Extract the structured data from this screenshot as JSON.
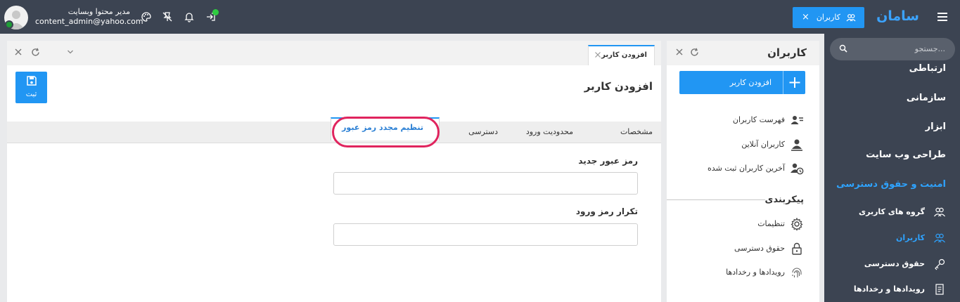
{
  "topbar": {
    "brand": "سامان",
    "open_tab": {
      "label": "کاربران",
      "icon": "users-icon",
      "close": "×"
    },
    "user": {
      "name": "مدیر محتوا وبسایت",
      "email": "content_admin@yahoo.com",
      "status_color": "#1e9d36"
    },
    "icons": [
      "palette-icon",
      "pin-off-icon",
      "bell-icon",
      "login-icon"
    ]
  },
  "sidebar": {
    "search_placeholder": "جستجو...",
    "categories": [
      {
        "label": "ارتباطی"
      },
      {
        "label": "سازمانی"
      },
      {
        "label": "ابزار"
      },
      {
        "label": "طراحی وب سایت"
      },
      {
        "label": "امنیت و حقوق دسترسی",
        "active": true
      }
    ],
    "sub_items": [
      {
        "label": "گروه های کاربری",
        "icon": "user-group-icon"
      },
      {
        "label": "کاربران",
        "icon": "users-icon",
        "active": true
      },
      {
        "label": "حقوق دسترسی",
        "icon": "key-icon"
      },
      {
        "label": "رویدادها و رخدادها",
        "icon": "document-log-icon"
      }
    ]
  },
  "users_panel": {
    "title": "کاربران",
    "add_button": "افزودن کاربر",
    "items": [
      {
        "label": "فهرست کاربران",
        "icon": "users-list-icon"
      },
      {
        "label": "کاربران آنلاین",
        "icon": "online-user-icon"
      },
      {
        "label": "آخرین کاربران ثبت شده",
        "icon": "user-clock-icon"
      }
    ],
    "section_title": "پیکربندی",
    "config_items": [
      {
        "label": "تنظیمات",
        "icon": "gear-icon"
      },
      {
        "label": "حقوق دسترسی",
        "icon": "lock-icon"
      },
      {
        "label": "رویدادها و رخدادها",
        "icon": "fingerprint-icon"
      }
    ]
  },
  "main_panel": {
    "doc_tab": "افزودن کاربر",
    "page_title": "افزودن کاربر",
    "save_button": "ثبت",
    "tabs": [
      {
        "label": "مشخصات"
      },
      {
        "label": "محدودیت ورود"
      },
      {
        "label": "دسترسی"
      },
      {
        "label": "تنظیم مجدد رمز عبور",
        "active": true
      }
    ],
    "fields": [
      {
        "label": "رمز عبور جدید",
        "value": ""
      },
      {
        "label": "تکرار رمز ورود",
        "value": ""
      }
    ]
  },
  "colors": {
    "accent": "#2196f3",
    "dark_bg": "#3c4452",
    "highlight": "#e0245e"
  }
}
